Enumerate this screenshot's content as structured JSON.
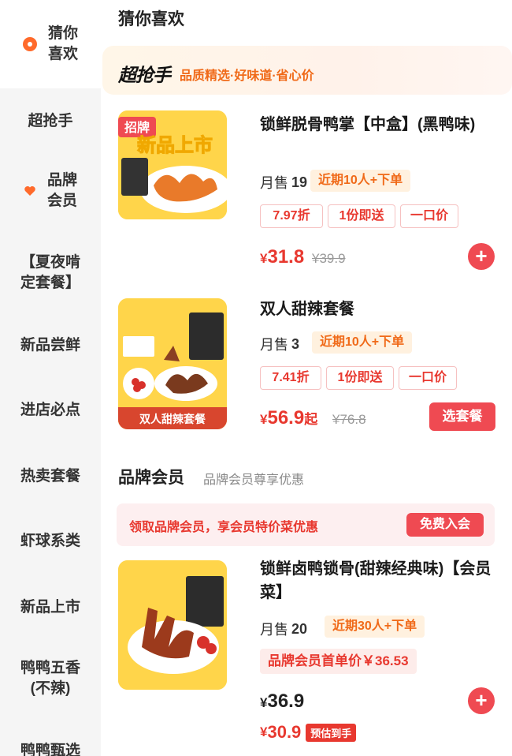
{
  "sidebar": {
    "items": [
      {
        "label_line1": "猜你",
        "label_line2": "喜欢",
        "icon": "target-icon",
        "active": true
      },
      {
        "label_line1": "超抢手",
        "label_line2": ""
      },
      {
        "label_line1": "品牌",
        "label_line2": "会员",
        "icon": "heart-icon"
      },
      {
        "label_line1": "【夏夜啃",
        "label_line2": "定套餐】"
      },
      {
        "label_line1": "新品尝鲜",
        "label_line2": ""
      },
      {
        "label_line1": "进店必点",
        "label_line2": ""
      },
      {
        "label_line1": "热卖套餐",
        "label_line2": ""
      },
      {
        "label_line1": "虾球系类",
        "label_line2": ""
      },
      {
        "label_line1": "新品上市",
        "label_line2": ""
      },
      {
        "label_line1": "鸭鸭五香",
        "label_line2": "(不辣)"
      },
      {
        "label_line1": "鸭鸭甄选",
        "label_line2": ""
      }
    ],
    "accent": "#ff6a2b"
  },
  "main": {
    "section_title": "猜你喜欢",
    "banner": {
      "logo": "超抢手",
      "slogan": "品质精选·好味道·省心价"
    },
    "products": [
      {
        "image_badge": "招牌",
        "image_caption": "新品上市",
        "name": "锁鲜脱骨鸭掌【中盒】(黑鸭味)",
        "sales_label": "月售",
        "sales_num": "19",
        "recent": "近期10人+下单",
        "tags": [
          "7.97折",
          "1份即送",
          "一口价"
        ],
        "currency": "¥",
        "price": "31.8",
        "orig_price": "¥39.9",
        "add_label": "+"
      },
      {
        "image_caption": "双人甜辣套餐",
        "name": "双人甜辣套餐",
        "sales_label": "月售",
        "sales_num": "3",
        "recent": "近期10人+下单",
        "tags": [
          "7.41折",
          "1份即送",
          "一口价"
        ],
        "currency": "¥",
        "price": "56.9",
        "price_suffix": "起",
        "orig_price": "¥76.8",
        "select_label": "选套餐"
      }
    ],
    "brand": {
      "title": "品牌会员",
      "subtitle": "品牌会员尊享优惠",
      "bar_text": "领取品牌会员，享会员特价菜优惠",
      "join_label": "免费入会"
    },
    "member_product": {
      "name": "锁鲜卤鸭锁骨(甜辣经典味)【会员菜】",
      "sales_label": "月售",
      "sales_num": "20",
      "recent": "近期30人+下单",
      "member_price": "品牌会员首单价￥36.53",
      "currency": "¥",
      "price": "36.9",
      "est_price": "30.9",
      "est_badge": "预估到手",
      "add_label": "+"
    }
  },
  "colors": {
    "primary_red": "#ef4a52",
    "orange": "#f06a19",
    "thumb_yellow": "#ffd54a"
  }
}
